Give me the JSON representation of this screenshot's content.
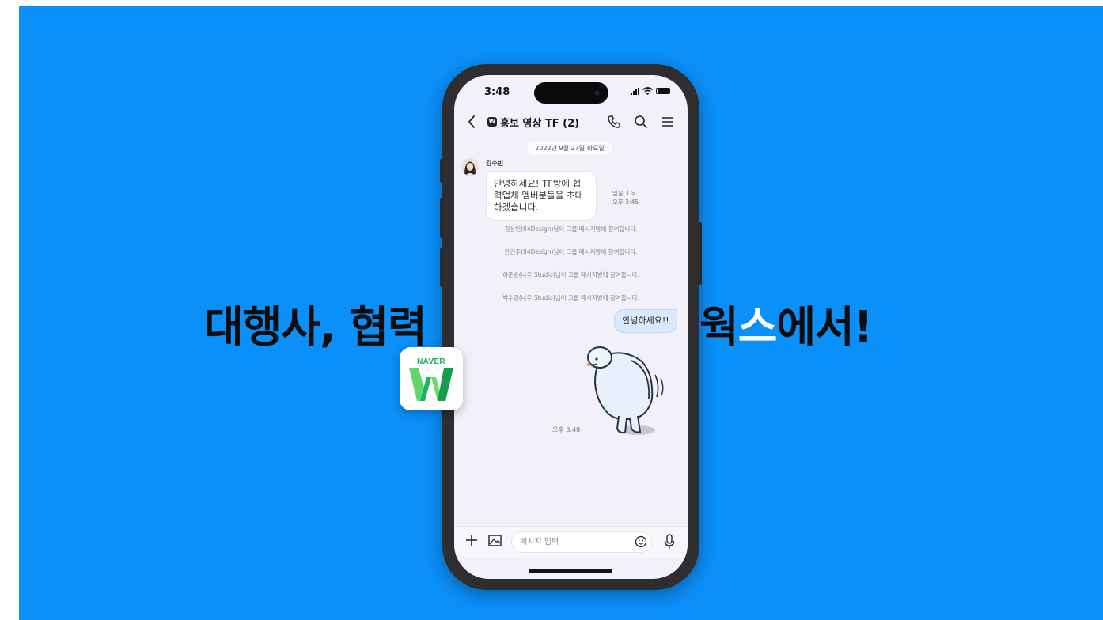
{
  "headline": {
    "left": "대행사, 협력",
    "right_plain": "웍",
    "right_highlight": "스",
    "right_tail": "에서!"
  },
  "logo": {
    "brand": "NAVER",
    "icon": "naver-works-w-logo"
  },
  "status": {
    "time": "3:48"
  },
  "chat": {
    "title": "홍보 영상 TF (2)",
    "title_badge": "W",
    "date": "2022년 9월 27일 화요일",
    "sender": "김수빈",
    "incoming_message": "안녕하세요! TF방에 협력업체 멤버분들을 초대하겠습니다.",
    "read_label": "읽음 3 >",
    "incoming_time": "오후 3:45",
    "system_messages": [
      "김상인(84Design)님이 그룹 메시지방에 참여합니다.",
      "한근주(84Design)님이 그룹 메시지방에 참여합니다.",
      "하준승(나우 Studio)님이 그룹 메시지방에 참여합니다.",
      "박수경(나우 Studio)님이 그룹 메시지방에 참여합니다."
    ],
    "outgoing_message": "안녕하세요!!",
    "outgoing_time": "오후 3:48"
  },
  "input": {
    "placeholder": "메시지 입력"
  },
  "colors": {
    "background": "#0b8ff8",
    "accent_green": "#1cb35a",
    "bubble_out": "#dbe9ff"
  }
}
